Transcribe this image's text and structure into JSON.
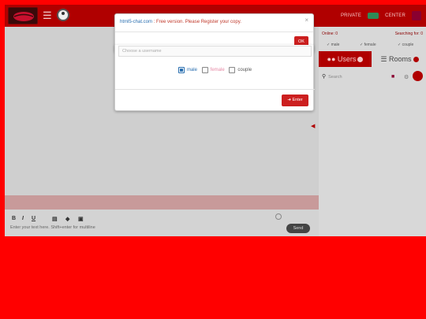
{
  "header": {
    "menu_icon": "hamburger-icon",
    "avatar_icon": "avatar-icon",
    "right_label_1": "PRIVATE",
    "right_label_2": "CENTER",
    "accent": "#b00000"
  },
  "right_panel": {
    "online_label": "Online: 0",
    "searching_label": "Searching for: 0",
    "filter_male": "male",
    "filter_female": "female",
    "filter_couple": "couple",
    "tab_users": "Users",
    "tab_rooms": "Rooms",
    "search_placeholder": "Search"
  },
  "editor": {
    "bold": "B",
    "italic": "I",
    "underline": "U",
    "hint": "Enter your text here. Shift+enter for multiline",
    "send_label": "Send"
  },
  "alert": {
    "brand": "html5-chat.com",
    "message": ": Free version. Please Register your copy.",
    "close": "×",
    "ok_label": "OK"
  },
  "login": {
    "username_placeholder": "Choose a username",
    "gender_male": "male",
    "gender_female": "female",
    "gender_couple": "couple",
    "selected_gender": "male",
    "enter_label": "Enter"
  },
  "colors": {
    "background": "#ff0000",
    "primary": "#b00000",
    "button": "#cc1f1f",
    "female": "#e68aa6",
    "link": "#2a6fb0"
  }
}
